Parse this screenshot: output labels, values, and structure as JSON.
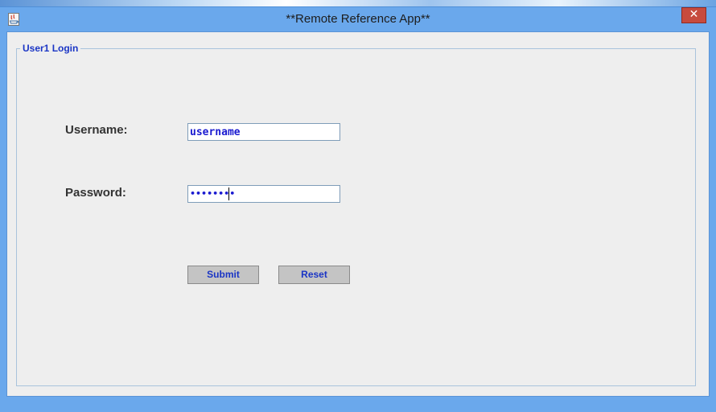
{
  "window": {
    "title": "**Remote Reference App**",
    "close_glyph": "✕",
    "icon": "java-app-icon"
  },
  "group": {
    "legend": "User1 Login"
  },
  "form": {
    "username_label": "Username:",
    "username_value": "username",
    "password_label": "Password:",
    "password_masked": "••••••••",
    "submit_label": "Submit",
    "reset_label": "Reset"
  },
  "colors": {
    "title_bar": "#6aa8ec",
    "close_button": "#c74b3e",
    "panel_background": "#eeeeee",
    "accent_text": "#1a35c5",
    "button_face": "#c4c4c4"
  }
}
